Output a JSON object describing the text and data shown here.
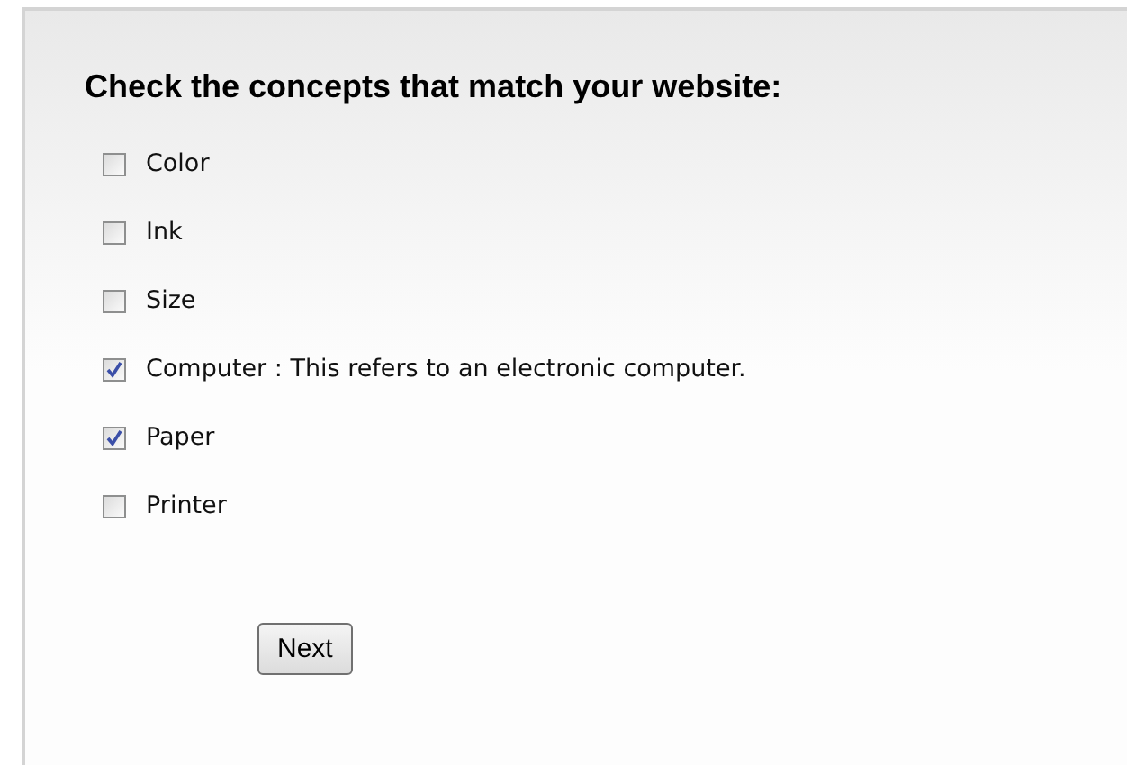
{
  "title": "Check the concepts that match your website:",
  "concepts": [
    {
      "label": "Color",
      "checked": false
    },
    {
      "label": "Ink",
      "checked": false
    },
    {
      "label": "Size",
      "checked": false
    },
    {
      "label": "Computer : This refers to an electronic computer.",
      "checked": true
    },
    {
      "label": "Paper",
      "checked": true
    },
    {
      "label": "Printer",
      "checked": false
    }
  ],
  "button": "Next"
}
